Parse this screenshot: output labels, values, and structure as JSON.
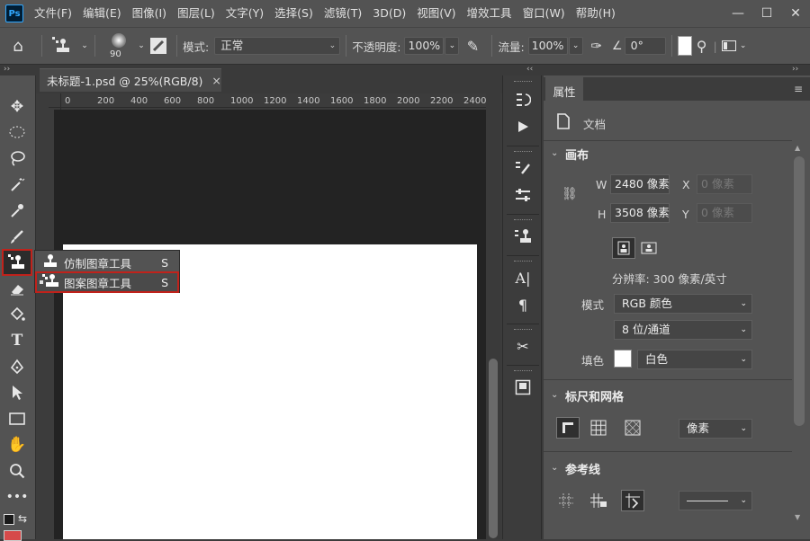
{
  "app": {
    "logo": "Ps"
  },
  "menu": [
    "文件(F)",
    "编辑(E)",
    "图像(I)",
    "图层(L)",
    "文字(Y)",
    "选择(S)",
    "滤镜(T)",
    "3D(D)",
    "视图(V)",
    "增效工具",
    "窗口(W)",
    "帮助(H)"
  ],
  "window_controls": {
    "minimize": "—",
    "maximize": "☐",
    "close": "✕"
  },
  "options": {
    "brush_size": "90",
    "mode_label": "模式:",
    "mode_value": "正常",
    "opacity_label": "不透明度:",
    "opacity_value": "100%",
    "flow_label": "流量:",
    "flow_value": "100%",
    "angle_value": "0°"
  },
  "strip": {
    "left": "››",
    "mid": "‹‹",
    "right": "››"
  },
  "document": {
    "tab_title": "未标题-1.psd @ 25%(RGB/8)",
    "close": "×",
    "ruler_ticks": [
      "0",
      "200",
      "400",
      "600",
      "800",
      "1000",
      "1200",
      "1400",
      "1600",
      "1800",
      "2000",
      "2200",
      "2400"
    ]
  },
  "flyout": {
    "items": [
      {
        "label": "仿制图章工具",
        "key": "S"
      },
      {
        "label": "图案图章工具",
        "key": "S"
      }
    ]
  },
  "properties": {
    "tab": "属性",
    "doc_label": "文档",
    "canvas_section": "画布",
    "w_label": "W",
    "w_value": "2480 像素",
    "h_label": "H",
    "h_value": "3508 像素",
    "x_label": "X",
    "x_value": "0 像素",
    "y_label": "Y",
    "y_value": "0 像素",
    "resolution": "分辨率: 300 像素/英寸",
    "mode_label": "模式",
    "mode_value": "RGB 颜色",
    "depth_value": "8 位/通道",
    "fill_label": "填色",
    "fill_value": "白色",
    "rulers_section": "标尺和网格",
    "unit_value": "像素",
    "guides_section": "参考线"
  },
  "colors": {
    "highlight": "#c0221b",
    "panel": "#535353",
    "dark": "#3c3c3c",
    "canvas": "#ffffff"
  }
}
